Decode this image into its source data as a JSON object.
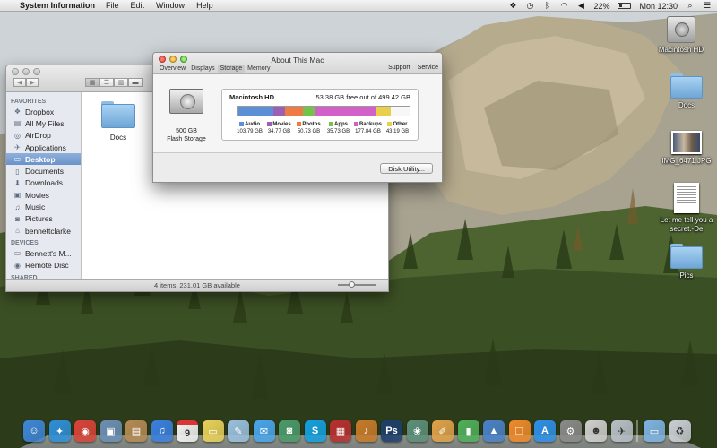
{
  "menubar": {
    "app_name": "System Information",
    "menus": [
      "File",
      "Edit",
      "Window",
      "Help"
    ],
    "battery_percent": "22%",
    "battery_level": 0.22,
    "clock": "Mon 12:30"
  },
  "desktop": {
    "icons": [
      {
        "label": "Macintosh HD",
        "icon": "hard-drive-icon"
      },
      {
        "label": "Docs",
        "icon": "folder-icon"
      },
      {
        "label": "IMG_6471.JPG",
        "icon": "photo-icon"
      },
      {
        "label": "Let me tell you a secret.-De",
        "icon": "document-icon"
      },
      {
        "label": "Pics",
        "icon": "folder-icon"
      }
    ]
  },
  "finder": {
    "sidebar": {
      "favorites_header": "FAVORITES",
      "favorites": [
        {
          "label": "Dropbox",
          "icon": "dropbox-icon"
        },
        {
          "label": "All My Files",
          "icon": "all-files-icon"
        },
        {
          "label": "AirDrop",
          "icon": "airdrop-icon"
        },
        {
          "label": "Applications",
          "icon": "applications-icon"
        },
        {
          "label": "Desktop",
          "icon": "desktop-icon",
          "selected": true
        },
        {
          "label": "Documents",
          "icon": "documents-icon"
        },
        {
          "label": "Downloads",
          "icon": "downloads-icon"
        },
        {
          "label": "Movies",
          "icon": "movies-icon"
        },
        {
          "label": "Music",
          "icon": "music-icon"
        },
        {
          "label": "Pictures",
          "icon": "pictures-icon"
        },
        {
          "label": "bennettclarke",
          "icon": "home-icon"
        }
      ],
      "devices_header": "DEVICES",
      "devices": [
        {
          "label": "Bennett's M...",
          "icon": "computer-icon"
        },
        {
          "label": "Remote Disc",
          "icon": "remote-disc-icon"
        }
      ],
      "shared_header": "SHARED"
    },
    "items": [
      {
        "label": "Docs",
        "icon": "folder-icon"
      }
    ],
    "status": "4 items, 231.01 GB available"
  },
  "about": {
    "title": "About This Mac",
    "tabs": [
      "Overview",
      "Displays",
      "Storage",
      "Memory"
    ],
    "active_tab": "Storage",
    "right_tabs": [
      "Support",
      "Service"
    ],
    "disk_caption_line1": "500 GB",
    "disk_caption_line2": "Flash Storage",
    "disk_name": "Macintosh HD",
    "free_text": "53.38 GB free out of 499.42 GB",
    "storage": [
      {
        "label": "Audio",
        "size": "103.79 GB",
        "gb": 103.79,
        "color": "#5b8fd6"
      },
      {
        "label": "Movies",
        "size": "34.77 GB",
        "gb": 34.77,
        "color": "#9b5fb3"
      },
      {
        "label": "Photos",
        "size": "50.73 GB",
        "gb": 50.73,
        "color": "#f07a44"
      },
      {
        "label": "Apps",
        "size": "35.73 GB",
        "gb": 35.73,
        "color": "#73c24a"
      },
      {
        "label": "Backups",
        "size": "177.84 GB",
        "gb": 177.84,
        "color": "#d35fc9"
      },
      {
        "label": "Other",
        "size": "43.19 GB",
        "gb": 43.19,
        "color": "#ead04a"
      }
    ],
    "total_gb": 499.42,
    "disk_utility_label": "Disk Utility..."
  },
  "dock": {
    "items": [
      {
        "name": "finder",
        "color": "#3e86d8",
        "glyph": "☺"
      },
      {
        "name": "safari",
        "color": "#2f8fd8",
        "glyph": "✦"
      },
      {
        "name": "chrome",
        "color": "#d9433a",
        "glyph": "◉"
      },
      {
        "name": "preview",
        "color": "#6c8fb5",
        "glyph": "▣"
      },
      {
        "name": "contacts",
        "color": "#b58a55",
        "glyph": "▤"
      },
      {
        "name": "itunes",
        "color": "#3a7fe0",
        "glyph": "♫"
      },
      {
        "name": "calendar",
        "color": "#f2f2f2",
        "glyph": "9"
      },
      {
        "name": "stickies",
        "color": "#e9d15a",
        "glyph": "▭"
      },
      {
        "name": "textedit",
        "color": "#9ac0de",
        "glyph": "✎"
      },
      {
        "name": "messages",
        "color": "#4aa6ec",
        "glyph": "✉"
      },
      {
        "name": "facetime",
        "color": "#4a9a6a",
        "glyph": "◙"
      },
      {
        "name": "skype",
        "color": "#14a0e0",
        "glyph": "S"
      },
      {
        "name": "photo-booth",
        "color": "#b82f2f",
        "glyph": "▦"
      },
      {
        "name": "garageband",
        "color": "#c77a2a",
        "glyph": "♪"
      },
      {
        "name": "photoshop",
        "color": "#1e3f6e",
        "glyph": "Ps"
      },
      {
        "name": "iphoto",
        "color": "#5c8f7a",
        "glyph": "❀"
      },
      {
        "name": "pages",
        "color": "#e0a24a",
        "glyph": "✐"
      },
      {
        "name": "numbers",
        "color": "#4faf5a",
        "glyph": "▮"
      },
      {
        "name": "keynote",
        "color": "#4a82c8",
        "glyph": "▲"
      },
      {
        "name": "ibooks",
        "color": "#f08a2a",
        "glyph": "❑"
      },
      {
        "name": "app-store",
        "color": "#2f8fe8",
        "glyph": "A"
      },
      {
        "name": "system-preferences",
        "color": "#8a8a8a",
        "glyph": "⚙"
      },
      {
        "name": "automator",
        "color": "#cfcfcf",
        "glyph": "☻"
      },
      {
        "name": "launchpad",
        "color": "#b8c0c8",
        "glyph": "✈"
      },
      {
        "name": "applications-folder",
        "color": "#7eb3e3",
        "glyph": "▭"
      },
      {
        "name": "trash",
        "color": "#c9ced4",
        "glyph": "♻"
      }
    ]
  }
}
